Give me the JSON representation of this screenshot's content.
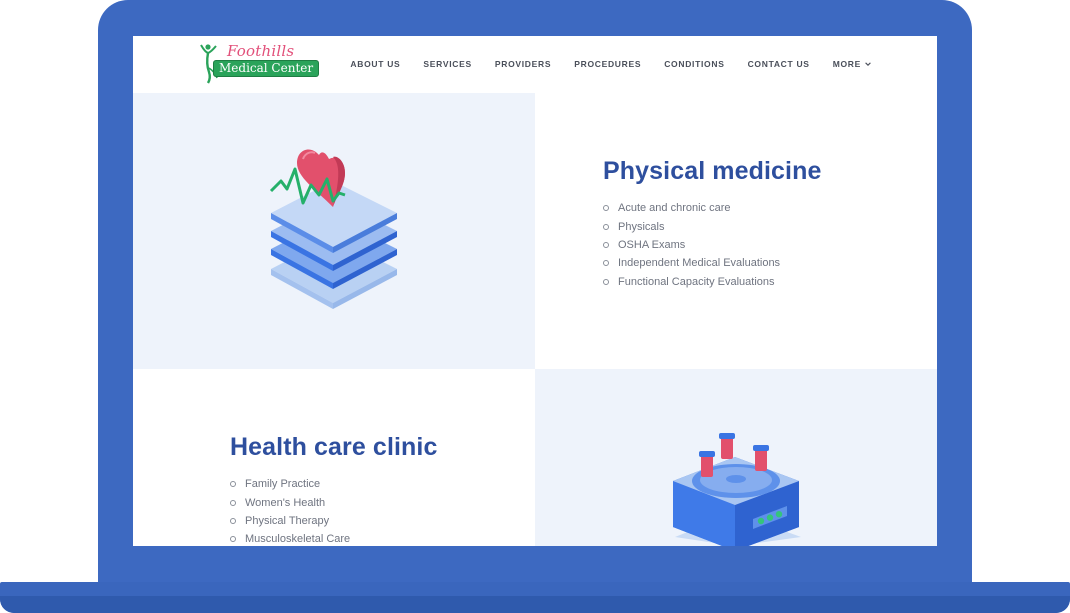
{
  "header": {
    "logo": {
      "line1": "Foothills",
      "line2": "Medical Center"
    },
    "nav": [
      {
        "label": "ABOUT US"
      },
      {
        "label": "SERVICES"
      },
      {
        "label": "PROVIDERS"
      },
      {
        "label": "PROCEDURES"
      },
      {
        "label": "CONDITIONS"
      },
      {
        "label": "CONTACT US"
      },
      {
        "label": "MORE",
        "icon": "chevron-down-icon"
      }
    ]
  },
  "sections": [
    {
      "title": "Physical medicine",
      "items": [
        "Acute and chronic care",
        "Physicals",
        "OSHA Exams",
        "Independent Medical Evaluations",
        "Functional Capacity Evaluations"
      ],
      "illustration": "heart-monitor-stack-illustration"
    },
    {
      "title": "Health care clinic",
      "items": [
        "Family Practice",
        "Women's Health",
        "Physical Therapy",
        "Musculoskeletal Care"
      ],
      "illustration": "lab-centrifuge-illustration"
    }
  ],
  "colors": {
    "frame": "#3d69c1",
    "heading": "#2e4f9e",
    "panel_tint": "#eef3fb",
    "logo_green": "#2aa35a",
    "logo_pink": "#e2507a"
  }
}
